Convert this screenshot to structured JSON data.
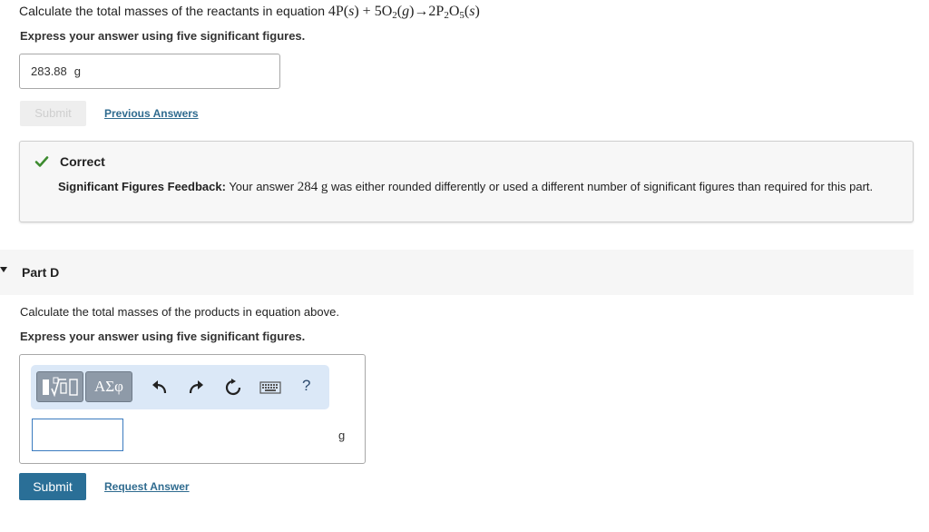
{
  "part_c": {
    "question_prefix": "Calculate the total masses of the reactants in equation",
    "instruction": "Express your answer using five significant figures.",
    "answer_value": "283.88",
    "answer_unit": "g",
    "submit_label": "Submit",
    "previous_answers_label": "Previous Answers",
    "feedback": {
      "status": "Correct",
      "heading": "Significant Figures Feedback:",
      "text_before": "Your answer",
      "answer_value": "284",
      "answer_unit": "g",
      "text_after": "was either rounded differently or used a different number of significant figures than required for this part."
    }
  },
  "part_d": {
    "label": "Part D",
    "question": "Calculate the total masses of the products in equation above.",
    "instruction": "Express your answer using five significant figures.",
    "toolbar": {
      "greek_label": "ΑΣφ",
      "help_label": "?",
      "icons": [
        "templates-icon",
        "greek-symbols-icon",
        "undo-icon",
        "redo-icon",
        "reset-icon",
        "keyboard-icon",
        "help-icon"
      ]
    },
    "answer_value": "",
    "answer_unit": "g",
    "submit_label": "Submit",
    "request_answer_label": "Request Answer"
  },
  "colors": {
    "submit_bg": "#2a6f97",
    "link": "#2f6b8f",
    "check": "#3d8b2f",
    "toolbar_bg": "#dbe8f7",
    "toolbar_btn": "#8e9aa8"
  }
}
